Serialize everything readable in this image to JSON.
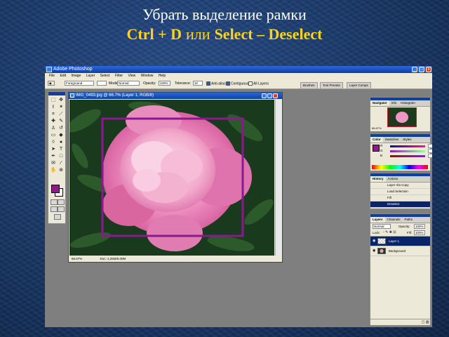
{
  "slide": {
    "title_line1": "Убрать выделение рамки",
    "title_shortcut": "Ctrl + D",
    "title_or": "или",
    "title_menu_path": "Select – Deselect"
  },
  "app": {
    "window_title": "Adobe Photoshop",
    "menu": [
      "File",
      "Edit",
      "Image",
      "Layer",
      "Select",
      "Filter",
      "View",
      "Window",
      "Help"
    ],
    "options": {
      "preset": "Foreground",
      "mode_label": "Mode:",
      "mode_value": "Normal",
      "opacity_label": "Opacity:",
      "opacity_value": "100%",
      "tolerance_label": "Tolerance:",
      "tolerance_value": "32",
      "anti_alias": "Anti-alias",
      "contiguous": "Contiguous",
      "all_layers": "All Layers"
    },
    "palette_well_tabs": [
      "Brushes",
      "Tool Presets",
      "Layer Comps"
    ]
  },
  "document": {
    "title": "IMG_0493.jpg @ 66.7% (Layer 1, RGB/8)",
    "zoom": "66.67%",
    "doc_size": "Doc: 2,25M/6.00M",
    "marquee_visible": true
  },
  "palettes": {
    "navigator": {
      "tabs": [
        "Navigator",
        "Info",
        "Histogram"
      ],
      "zoom": "66.67%"
    },
    "color": {
      "tabs": [
        "Color",
        "Swatches",
        "Styles"
      ],
      "rows": [
        {
          "label": "R",
          "value": "148"
        },
        {
          "label": "G",
          "value": "16"
        },
        {
          "label": "B",
          "value": "160"
        }
      ]
    },
    "history": {
      "tabs": [
        "History",
        "Actions"
      ],
      "items": [
        "Layer Via Copy",
        "Load Selection",
        "Fill",
        "Deselect"
      ],
      "selected": 3
    },
    "layers": {
      "tabs": [
        "Layers",
        "Channels",
        "Paths"
      ],
      "blend": "Normal",
      "opacity_label": "Opacity:",
      "opacity": "100%",
      "lock_label": "Lock:",
      "fill_label": "Fill:",
      "fill": "100%",
      "items": [
        "Layer 1",
        "Background"
      ]
    }
  },
  "colors": {
    "foreground": "#8f1a90",
    "background": "#ffffff",
    "marquee": "#8a1a8c",
    "selection_highlight": "#0a246a"
  }
}
